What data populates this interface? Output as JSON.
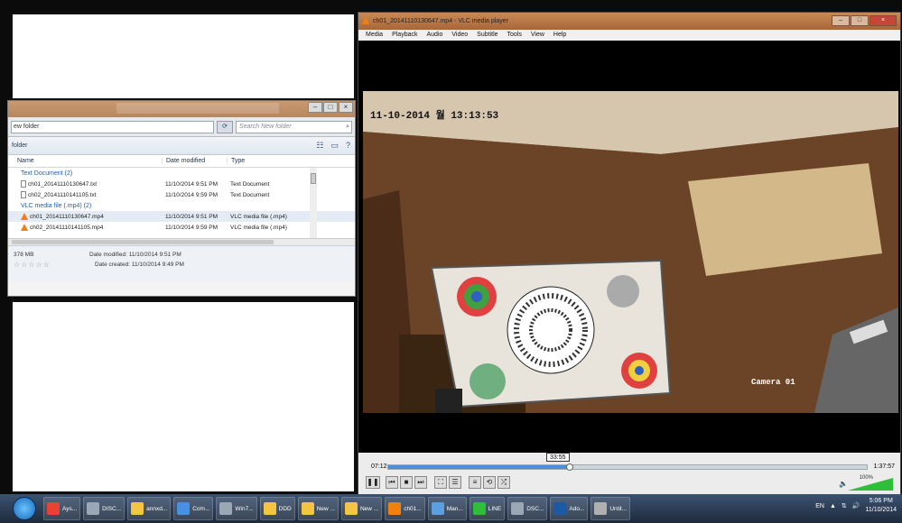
{
  "explorer": {
    "address": "ew folder",
    "search_placeholder": "Search New folder",
    "toolbar_label": "folder",
    "columns": {
      "name": "Name",
      "date": "Date modified",
      "type": "Type"
    },
    "groups": [
      {
        "label": "Text Document (2)",
        "files": [
          {
            "name": "ch01_20141110130647.txt",
            "date": "11/10/2014 9:51 PM",
            "type": "Text Document"
          },
          {
            "name": "ch02_20141110141105.txt",
            "date": "11/10/2014 9:59 PM",
            "type": "Text Document"
          }
        ]
      },
      {
        "label": "VLC media file (.mp4) (2)",
        "files": [
          {
            "name": "ch01_20141110130647.mp4",
            "date": "11/10/2014 9:51 PM",
            "type": "VLC media file (.mp4)"
          },
          {
            "name": "ch02_20141110141105.mp4",
            "date": "11/10/2014 9:59 PM",
            "type": "VLC media file (.mp4)"
          }
        ]
      }
    ],
    "details": {
      "size": "378 MB",
      "stars": "☆☆☆☆☆",
      "date_modified": "Date modified: 11/10/2014 9:51 PM",
      "date_created": "Date created: 11/10/2014 9:49 PM"
    }
  },
  "vlc": {
    "title": "ch01_20141110130647.mp4 - VLC media player",
    "menu": [
      "Media",
      "Playback",
      "Audio",
      "Video",
      "Subtitle",
      "Tools",
      "View",
      "Help"
    ],
    "osd_timestamp": "11-10-2014 월 13:13:53",
    "camera_label": "Camera 01",
    "time_elapsed": "07:12",
    "time_total": "1:37:57",
    "seek_tooltip": "33:55",
    "seek_progress": 0.38,
    "volume_percent": "100%"
  },
  "taskbar": {
    "items": [
      {
        "label": "Ays...",
        "color": "#e94235"
      },
      {
        "label": "DISC...",
        "color": "#9aa7b5"
      },
      {
        "label": "annxd...",
        "color": "#f4c542"
      },
      {
        "label": "Com...",
        "color": "#4a90e2"
      },
      {
        "label": "Win7...",
        "color": "#9aa7b5"
      },
      {
        "label": "DDD",
        "color": "#f4c542"
      },
      {
        "label": "New ...",
        "color": "#f4c542"
      },
      {
        "label": "New ...",
        "color": "#f4c542"
      },
      {
        "label": "ch01...",
        "color": "#f08010"
      },
      {
        "label": "Man...",
        "color": "#5aa0e0"
      },
      {
        "label": "LINE",
        "color": "#2fbe3a"
      },
      {
        "label": "DSC...",
        "color": "#9aa7b5"
      },
      {
        "label": "Ado...",
        "color": "#1c5aa6"
      },
      {
        "label": "Untit...",
        "color": "#b0b0b0"
      }
    ],
    "lang": "EN",
    "time": "5:06 PM",
    "date": "11/10/2014"
  }
}
